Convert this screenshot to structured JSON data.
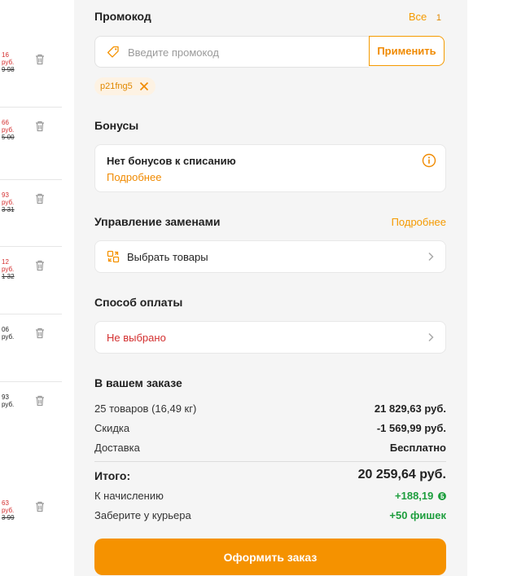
{
  "cart_items": [
    {
      "price_new": "16",
      "unit": "руб.",
      "price_old": "9 98",
      "new_is_red": true
    },
    {
      "price_new": "66",
      "unit": "руб.",
      "price_old": "5 00",
      "new_is_red": true
    },
    {
      "price_new": "93",
      "unit": "руб.",
      "price_old": "3 31",
      "new_is_red": true
    },
    {
      "price_new": "12",
      "unit": "руб.",
      "price_old": "1 32",
      "new_is_red": true
    },
    {
      "price_new": "06",
      "unit": "руб.",
      "price_old": "",
      "new_is_red": false
    },
    {
      "price_new": "93",
      "unit": "руб.",
      "price_old": "",
      "new_is_red": false
    },
    {
      "price_new": "63",
      "unit": "руб.",
      "price_old": "3 99",
      "new_is_red": true
    }
  ],
  "promo": {
    "title": "Промокод",
    "all_label": "Все",
    "all_count": "1",
    "placeholder": "Введите промокод",
    "apply_label": "Применить",
    "applied_code": "p21fng5"
  },
  "bonuses": {
    "title": "Бонусы",
    "main_text": "Нет бонусов к списанию",
    "more_link": "Подробнее"
  },
  "replacements": {
    "title": "Управление заменами",
    "more_link": "Подробнее",
    "select_label": "Выбрать товары"
  },
  "payment": {
    "title": "Способ оплаты",
    "status": "Не выбрано"
  },
  "summary": {
    "title": "В вашем заказе",
    "items_label": "25 товаров (16,49 кг)",
    "items_value": "21 829,63 руб.",
    "discount_label": "Скидка",
    "discount_value": "-1 569,99 руб.",
    "delivery_label": "Доставка",
    "delivery_value": "Бесплатно",
    "total_label": "Итого:",
    "total_value": "20 259,64 руб.",
    "accrual_label": "К начислению",
    "accrual_value": "+188,19",
    "courier_label": "Заберите у курьера",
    "courier_value": "+50 фишек"
  },
  "checkout_label": "Оформить заказ",
  "colors": {
    "accent": "#f59200",
    "link": "#f08a00",
    "error": "#d32f2f",
    "positive": "#1e9e3e",
    "panel_bg": "#f5f5f5"
  }
}
